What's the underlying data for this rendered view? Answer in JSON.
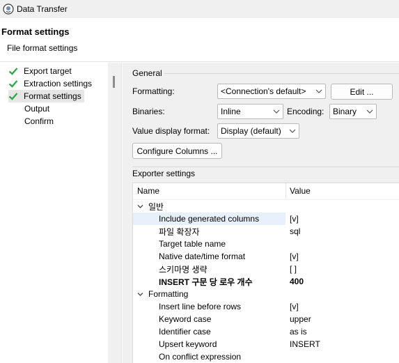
{
  "window": {
    "title": "Data Transfer"
  },
  "header": {
    "title": "Format settings",
    "subtitle": "File format settings"
  },
  "nav": {
    "items": [
      {
        "label": "Export target",
        "done": true
      },
      {
        "label": "Extraction settings",
        "done": true
      },
      {
        "label": "Format settings",
        "done": true,
        "selected": true
      },
      {
        "label": "Output",
        "done": false
      },
      {
        "label": "Confirm",
        "done": false
      }
    ]
  },
  "general": {
    "title": "General",
    "formatting_label": "Formatting:",
    "formatting_value": "<Connection's default>",
    "edit_button": "Edit ...",
    "binaries_label": "Binaries:",
    "binaries_value": "Inline",
    "encoding_label": "Encoding:",
    "encoding_value": "Binary",
    "value_display_label": "Value display format:",
    "value_display_value": "Display (default)",
    "configure_columns_button": "Configure Columns ..."
  },
  "exporter": {
    "title": "Exporter settings",
    "columns": {
      "name": "Name",
      "value": "Value"
    },
    "groups": [
      {
        "label": "일반",
        "rows": [
          {
            "name": "Include generated columns",
            "value": "[v]",
            "selected": true
          },
          {
            "name": "파일 확장자",
            "value": "sql"
          },
          {
            "name": "Target table name",
            "value": ""
          },
          {
            "name": "Native date/time format",
            "value": "[v]"
          },
          {
            "name": "스키마명 생략",
            "value": "[ ]"
          },
          {
            "name": "INSERT 구문 당 로우 개수",
            "value": "400",
            "bold": true
          }
        ]
      },
      {
        "label": "Formatting",
        "rows": [
          {
            "name": "Insert line before rows",
            "value": "[v]"
          },
          {
            "name": "Keyword case",
            "value": "upper"
          },
          {
            "name": "Identifier case",
            "value": "as is"
          },
          {
            "name": "Upsert keyword",
            "value": "INSERT"
          },
          {
            "name": "On conflict expression",
            "value": ""
          }
        ]
      }
    ]
  },
  "colors": {
    "check": "#2ea84a",
    "selection": "#e8f0fb",
    "panel": "#f0f0f0"
  }
}
